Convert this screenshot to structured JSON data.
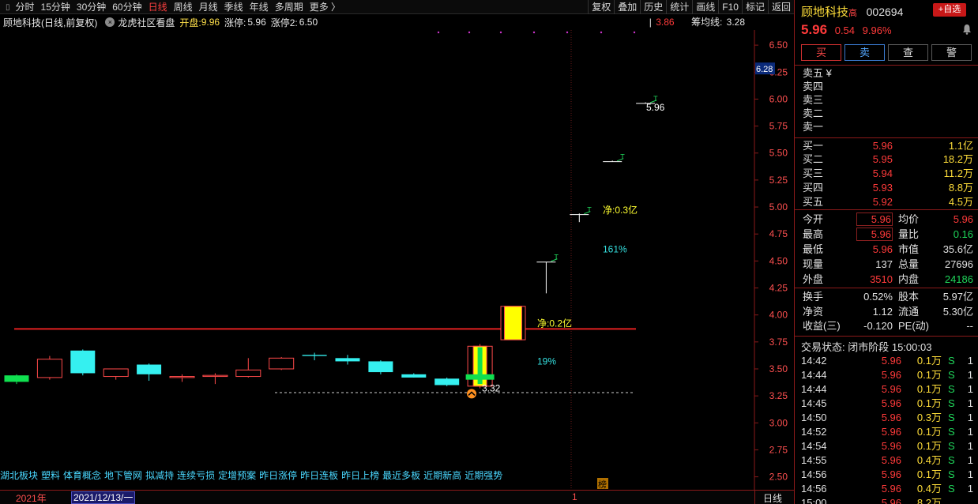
{
  "toolbar": {
    "items": [
      "分时",
      "15分钟",
      "30分钟",
      "60分钟",
      "日线",
      "周线",
      "月线",
      "季线",
      "年线",
      "多周期",
      "更多 〉"
    ],
    "active_index": 4,
    "right_buttons": [
      "复权",
      "叠加",
      "历史",
      "统计",
      "画线",
      "F10",
      "标记",
      "返回"
    ]
  },
  "infobar": {
    "title": "顾地科技(日线,前复权)",
    "indicator": "龙虎社区看盘",
    "open_label": "开盘:",
    "open_value": "9.96",
    "zt_label": "涨停:",
    "zt_value": "5.96",
    "zt2_label": "涨停2:",
    "zt2_value": "6.50",
    "right_value": "3.86",
    "avg_label": "筹均线:",
    "avg_value": "3.28"
  },
  "chart_data": {
    "type": "candlestick",
    "ylim": [
      2.38,
      6.64
    ],
    "y_ticks": [
      "6.50",
      "6.25",
      "6.00",
      "5.75",
      "5.50",
      "5.25",
      "5.00",
      "4.75",
      "4.50",
      "4.25",
      "4.00",
      "3.75",
      "3.50",
      "3.25",
      "3.00",
      "2.75",
      "2.50"
    ],
    "current_price_tag": "6.28",
    "candles": [
      {
        "o": 3.38,
        "h": 3.45,
        "l": 3.36,
        "c": 3.44,
        "color": "green"
      },
      {
        "o": 3.42,
        "h": 3.62,
        "l": 3.4,
        "c": 3.59,
        "color": "red"
      },
      {
        "o": 3.67,
        "h": 3.68,
        "l": 3.44,
        "c": 3.46,
        "color": "cyan"
      },
      {
        "o": 3.43,
        "h": 3.5,
        "l": 3.4,
        "c": 3.5,
        "color": "red"
      },
      {
        "o": 3.54,
        "h": 3.55,
        "l": 3.39,
        "c": 3.45,
        "color": "cyan"
      },
      {
        "o": 3.42,
        "h": 3.45,
        "l": 3.38,
        "c": 3.43,
        "color": "red"
      },
      {
        "o": 3.43,
        "h": 3.46,
        "l": 3.36,
        "c": 3.44,
        "color": "red"
      },
      {
        "o": 3.43,
        "h": 3.6,
        "l": 3.42,
        "c": 3.49,
        "color": "red"
      },
      {
        "o": 3.5,
        "h": 3.61,
        "l": 3.49,
        "c": 3.6,
        "color": "red"
      },
      {
        "o": 3.63,
        "h": 3.65,
        "l": 3.58,
        "c": 3.62,
        "color": "cyan"
      },
      {
        "o": 3.6,
        "h": 3.63,
        "l": 3.54,
        "c": 3.57,
        "color": "cyan"
      },
      {
        "o": 3.57,
        "h": 3.58,
        "l": 3.45,
        "c": 3.47,
        "color": "cyan"
      },
      {
        "o": 3.45,
        "h": 3.46,
        "l": 3.42,
        "c": 3.42,
        "color": "cyan"
      },
      {
        "o": 3.41,
        "h": 3.42,
        "l": 3.34,
        "c": 3.35,
        "color": "cyan"
      },
      {
        "o": 3.34,
        "h": 3.73,
        "l": 3.32,
        "c": 3.71,
        "color": "red"
      },
      {
        "o": 3.77,
        "h": 4.08,
        "l": 3.77,
        "c": 4.08,
        "color": "red"
      },
      {
        "o": 4.49,
        "h": 4.49,
        "l": 4.2,
        "c": 4.49,
        "color": "doji"
      },
      {
        "o": 4.93,
        "h": 4.94,
        "l": 4.86,
        "c": 4.93,
        "color": "doji"
      },
      {
        "o": 5.42,
        "h": 5.43,
        "l": 5.42,
        "c": 5.42,
        "color": "doji"
      },
      {
        "o": 5.96,
        "h": 5.97,
        "l": 5.96,
        "c": 5.96,
        "color": "doji"
      }
    ],
    "support_line": 3.87,
    "dashed_line": 3.28,
    "annotations": {
      "net1": "净:0.3亿",
      "pct1": "161%",
      "net2": "净:0.2亿",
      "pct2": "19%",
      "low_label": "3.32",
      "high_label": "5.96"
    }
  },
  "tags": [
    "湖北板块",
    "塑料",
    "体育概念",
    "地下管网",
    "拟减持",
    "连续亏损",
    "定增预案",
    "昨日涨停",
    "昨日连板",
    "昨日上榜",
    "最近多板",
    "近期新高",
    "近期强势"
  ],
  "bang_label": "榜",
  "datebar": {
    "year": "2021年",
    "current_date": "2021/12/13/一",
    "mark": "1",
    "period": "日线"
  },
  "panel": {
    "name": "顾地科技",
    "gao": "高",
    "code": "002694",
    "add_label": "+自选",
    "price": "5.96",
    "change": "0.54",
    "change_pct": "9.96%",
    "trade_buttons": [
      "买",
      "卖",
      "查",
      "警"
    ],
    "asks": [
      {
        "label": "卖五 ¥",
        "price": "",
        "vol": ""
      },
      {
        "label": "卖四",
        "price": "",
        "vol": ""
      },
      {
        "label": "卖三",
        "price": "",
        "vol": ""
      },
      {
        "label": "卖二",
        "price": "",
        "vol": ""
      },
      {
        "label": "卖一",
        "price": "",
        "vol": ""
      }
    ],
    "bids": [
      {
        "label": "买一",
        "price": "5.96",
        "vol": "1.1亿"
      },
      {
        "label": "买二",
        "price": "5.95",
        "vol": "18.2万"
      },
      {
        "label": "买三",
        "price": "5.94",
        "vol": "11.2万"
      },
      {
        "label": "买四",
        "price": "5.93",
        "vol": "8.8万"
      },
      {
        "label": "买五",
        "price": "5.92",
        "vol": "4.5万"
      }
    ],
    "stats1": [
      {
        "l1": "今开",
        "v1": "5.96",
        "c1": "red",
        "box": true,
        "l2": "均价",
        "v2": "5.96",
        "c2": "red"
      },
      {
        "l1": "最高",
        "v1": "5.96",
        "c1": "red",
        "box": true,
        "l2": "量比",
        "v2": "0.16",
        "c2": "green"
      },
      {
        "l1": "最低",
        "v1": "5.96",
        "c1": "red",
        "box": false,
        "l2": "市值",
        "v2": "35.6亿",
        "c2": "white"
      },
      {
        "l1": "现量",
        "v1": "137",
        "c1": "white",
        "box": false,
        "l2": "总量",
        "v2": "27696",
        "c2": "white"
      },
      {
        "l1": "外盘",
        "v1": "3510",
        "c1": "red",
        "box": false,
        "l2": "内盘",
        "v2": "24186",
        "c2": "green"
      }
    ],
    "stats2": [
      {
        "l1": "换手",
        "v1": "0.52%",
        "c1": "white",
        "box": false,
        "l2": "股本",
        "v2": "5.97亿",
        "c2": "white"
      },
      {
        "l1": "净资",
        "v1": "1.12",
        "c1": "white",
        "box": false,
        "l2": "流通",
        "v2": "5.30亿",
        "c2": "white"
      },
      {
        "l1": "收益(三)",
        "v1": "-0.120",
        "c1": "white",
        "box": false,
        "l2": "PE(动)",
        "v2": "--",
        "c2": "white"
      }
    ],
    "trade_status": "交易状态: 闭市阶段 15:00:03",
    "ticks": [
      {
        "t": "14:42",
        "p": "5.96",
        "v": "0.1万",
        "s": "S",
        "n": "1"
      },
      {
        "t": "14:44",
        "p": "5.96",
        "v": "0.1万",
        "s": "S",
        "n": "1"
      },
      {
        "t": "14:44",
        "p": "5.96",
        "v": "0.1万",
        "s": "S",
        "n": "1"
      },
      {
        "t": "14:45",
        "p": "5.96",
        "v": "0.1万",
        "s": "S",
        "n": "1"
      },
      {
        "t": "14:50",
        "p": "5.96",
        "v": "0.3万",
        "s": "S",
        "n": "1"
      },
      {
        "t": "14:52",
        "p": "5.96",
        "v": "0.1万",
        "s": "S",
        "n": "1"
      },
      {
        "t": "14:54",
        "p": "5.96",
        "v": "0.1万",
        "s": "S",
        "n": "1"
      },
      {
        "t": "14:55",
        "p": "5.96",
        "v": "0.4万",
        "s": "S",
        "n": "1"
      },
      {
        "t": "14:56",
        "p": "5.96",
        "v": "0.1万",
        "s": "S",
        "n": "1"
      },
      {
        "t": "14:56",
        "p": "5.96",
        "v": "0.4万",
        "s": "S",
        "n": "1"
      },
      {
        "t": "15:00",
        "p": "5.96",
        "v": "8.2万",
        "s": "",
        "n": ""
      }
    ]
  }
}
